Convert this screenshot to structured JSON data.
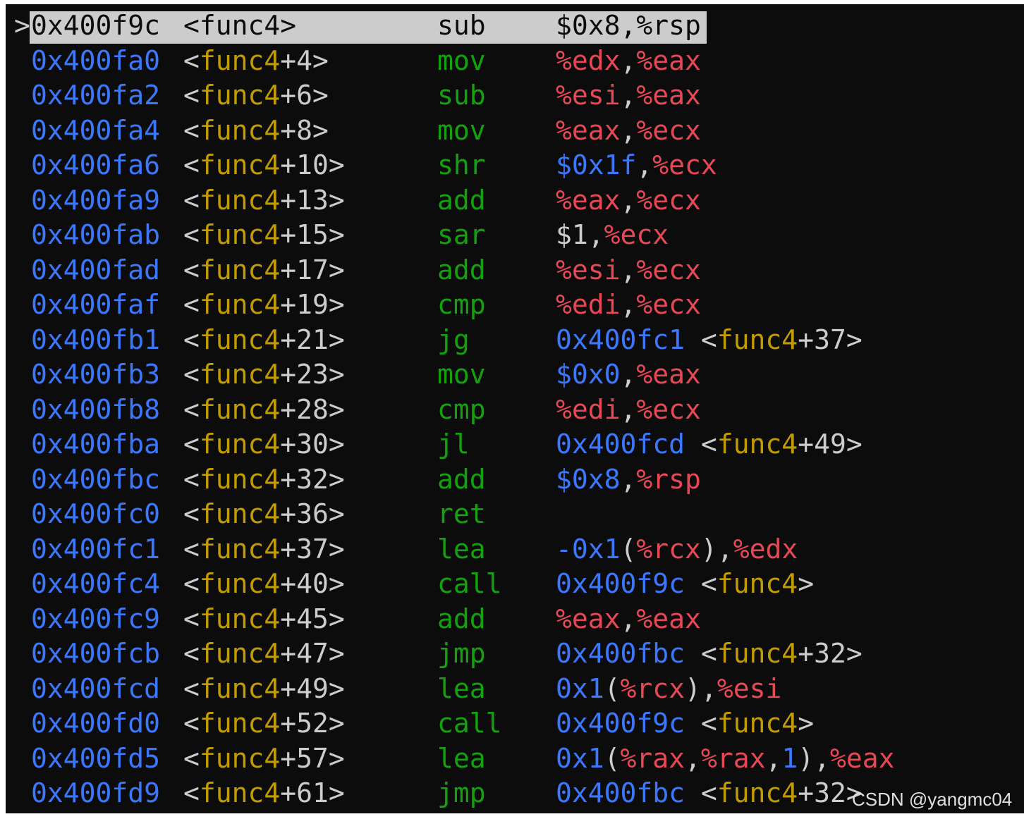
{
  "colors": {
    "background": "#0c0c0c",
    "address": "#3b78ff",
    "symbol_bracket": "#cccccc",
    "symbol_name": "#c19c00",
    "symbol_offset": "#cccccc",
    "mnemonic": "#13a10e",
    "register": "#e74856",
    "immediate": "#3b78ff",
    "punctuation": "#cccccc",
    "selection_bg": "#cccccc",
    "selection_fg": "#0c0c0c"
  },
  "disassembly": {
    "selected_marker": ">",
    "rows": [
      {
        "address": "0x400f9c",
        "symbol": "func4",
        "offset": "",
        "mnemonic": "sub",
        "operands": [
          [
            "$0x8",
            "imm"
          ],
          [
            ",",
            "p"
          ],
          [
            "%rsp",
            "reg"
          ]
        ],
        "selected": true
      },
      {
        "address": "0x400fa0",
        "symbol": "func4",
        "offset": "+4",
        "mnemonic": "mov",
        "operands": [
          [
            "%edx",
            "reg"
          ],
          [
            ",",
            "p"
          ],
          [
            "%eax",
            "reg"
          ]
        ]
      },
      {
        "address": "0x400fa2",
        "symbol": "func4",
        "offset": "+6",
        "mnemonic": "sub",
        "operands": [
          [
            "%esi",
            "reg"
          ],
          [
            ",",
            "p"
          ],
          [
            "%eax",
            "reg"
          ]
        ]
      },
      {
        "address": "0x400fa4",
        "symbol": "func4",
        "offset": "+8",
        "mnemonic": "mov",
        "operands": [
          [
            "%eax",
            "reg"
          ],
          [
            ",",
            "p"
          ],
          [
            "%ecx",
            "reg"
          ]
        ]
      },
      {
        "address": "0x400fa6",
        "symbol": "func4",
        "offset": "+10",
        "mnemonic": "shr",
        "operands": [
          [
            "$0x1f",
            "imm"
          ],
          [
            ",",
            "p"
          ],
          [
            "%ecx",
            "reg"
          ]
        ]
      },
      {
        "address": "0x400fa9",
        "symbol": "func4",
        "offset": "+13",
        "mnemonic": "add",
        "operands": [
          [
            "%eax",
            "reg"
          ],
          [
            ",",
            "p"
          ],
          [
            "%ecx",
            "reg"
          ]
        ]
      },
      {
        "address": "0x400fab",
        "symbol": "func4",
        "offset": "+15",
        "mnemonic": "sar",
        "operands": [
          [
            "$1",
            "p"
          ],
          [
            ",",
            "p"
          ],
          [
            "%ecx",
            "reg"
          ]
        ]
      },
      {
        "address": "0x400fad",
        "symbol": "func4",
        "offset": "+17",
        "mnemonic": "add",
        "operands": [
          [
            "%esi",
            "reg"
          ],
          [
            ",",
            "p"
          ],
          [
            "%ecx",
            "reg"
          ]
        ]
      },
      {
        "address": "0x400faf",
        "symbol": "func4",
        "offset": "+19",
        "mnemonic": "cmp",
        "operands": [
          [
            "%edi",
            "reg"
          ],
          [
            ",",
            "p"
          ],
          [
            "%ecx",
            "reg"
          ]
        ]
      },
      {
        "address": "0x400fb1",
        "symbol": "func4",
        "offset": "+21",
        "mnemonic": "jg",
        "operands": [
          [
            "0x400fc1",
            "imm"
          ],
          [
            " <",
            "p"
          ],
          [
            "func4",
            "sym"
          ],
          [
            "+37>",
            "p"
          ]
        ]
      },
      {
        "address": "0x400fb3",
        "symbol": "func4",
        "offset": "+23",
        "mnemonic": "mov",
        "operands": [
          [
            "$0x0",
            "imm"
          ],
          [
            ",",
            "p"
          ],
          [
            "%eax",
            "reg"
          ]
        ]
      },
      {
        "address": "0x400fb8",
        "symbol": "func4",
        "offset": "+28",
        "mnemonic": "cmp",
        "operands": [
          [
            "%edi",
            "reg"
          ],
          [
            ",",
            "p"
          ],
          [
            "%ecx",
            "reg"
          ]
        ]
      },
      {
        "address": "0x400fba",
        "symbol": "func4",
        "offset": "+30",
        "mnemonic": "jl",
        "operands": [
          [
            "0x400fcd",
            "imm"
          ],
          [
            " <",
            "p"
          ],
          [
            "func4",
            "sym"
          ],
          [
            "+49>",
            "p"
          ]
        ]
      },
      {
        "address": "0x400fbc",
        "symbol": "func4",
        "offset": "+32",
        "mnemonic": "add",
        "operands": [
          [
            "$0x8",
            "imm"
          ],
          [
            ",",
            "p"
          ],
          [
            "%rsp",
            "reg"
          ]
        ]
      },
      {
        "address": "0x400fc0",
        "symbol": "func4",
        "offset": "+36",
        "mnemonic": "ret",
        "operands": []
      },
      {
        "address": "0x400fc1",
        "symbol": "func4",
        "offset": "+37",
        "mnemonic": "lea",
        "operands": [
          [
            "-0x1",
            "imm"
          ],
          [
            "(",
            "p"
          ],
          [
            "%rcx",
            "reg"
          ],
          [
            "),",
            "p"
          ],
          [
            "%edx",
            "reg"
          ]
        ]
      },
      {
        "address": "0x400fc4",
        "symbol": "func4",
        "offset": "+40",
        "mnemonic": "call",
        "operands": [
          [
            "0x400f9c",
            "imm"
          ],
          [
            " <",
            "p"
          ],
          [
            "func4",
            "sym"
          ],
          [
            ">",
            "p"
          ]
        ]
      },
      {
        "address": "0x400fc9",
        "symbol": "func4",
        "offset": "+45",
        "mnemonic": "add",
        "operands": [
          [
            "%eax",
            "reg"
          ],
          [
            ",",
            "p"
          ],
          [
            "%eax",
            "reg"
          ]
        ]
      },
      {
        "address": "0x400fcb",
        "symbol": "func4",
        "offset": "+47",
        "mnemonic": "jmp",
        "operands": [
          [
            "0x400fbc",
            "imm"
          ],
          [
            " <",
            "p"
          ],
          [
            "func4",
            "sym"
          ],
          [
            "+32>",
            "p"
          ]
        ]
      },
      {
        "address": "0x400fcd",
        "symbol": "func4",
        "offset": "+49",
        "mnemonic": "lea",
        "operands": [
          [
            "0x1",
            "imm"
          ],
          [
            "(",
            "p"
          ],
          [
            "%rcx",
            "reg"
          ],
          [
            "),",
            "p"
          ],
          [
            "%esi",
            "reg"
          ]
        ]
      },
      {
        "address": "0x400fd0",
        "symbol": "func4",
        "offset": "+52",
        "mnemonic": "call",
        "operands": [
          [
            "0x400f9c",
            "imm"
          ],
          [
            " <",
            "p"
          ],
          [
            "func4",
            "sym"
          ],
          [
            ">",
            "p"
          ]
        ]
      },
      {
        "address": "0x400fd5",
        "symbol": "func4",
        "offset": "+57",
        "mnemonic": "lea",
        "operands": [
          [
            "0x1",
            "imm"
          ],
          [
            "(",
            "p"
          ],
          [
            "%rax",
            "reg"
          ],
          [
            ",",
            "p"
          ],
          [
            "%rax",
            "reg"
          ],
          [
            ",",
            "p"
          ],
          [
            "1",
            "imm"
          ],
          [
            "),",
            "p"
          ],
          [
            "%eax",
            "reg"
          ]
        ]
      },
      {
        "address": "0x400fd9",
        "symbol": "func4",
        "offset": "+61",
        "mnemonic": "jmp",
        "operands": [
          [
            "0x400fbc",
            "imm"
          ],
          [
            " <",
            "p"
          ],
          [
            "func4",
            "sym"
          ],
          [
            "+32>",
            "p"
          ]
        ]
      }
    ]
  },
  "watermark": {
    "text": "CSDN @yangmc04"
  }
}
